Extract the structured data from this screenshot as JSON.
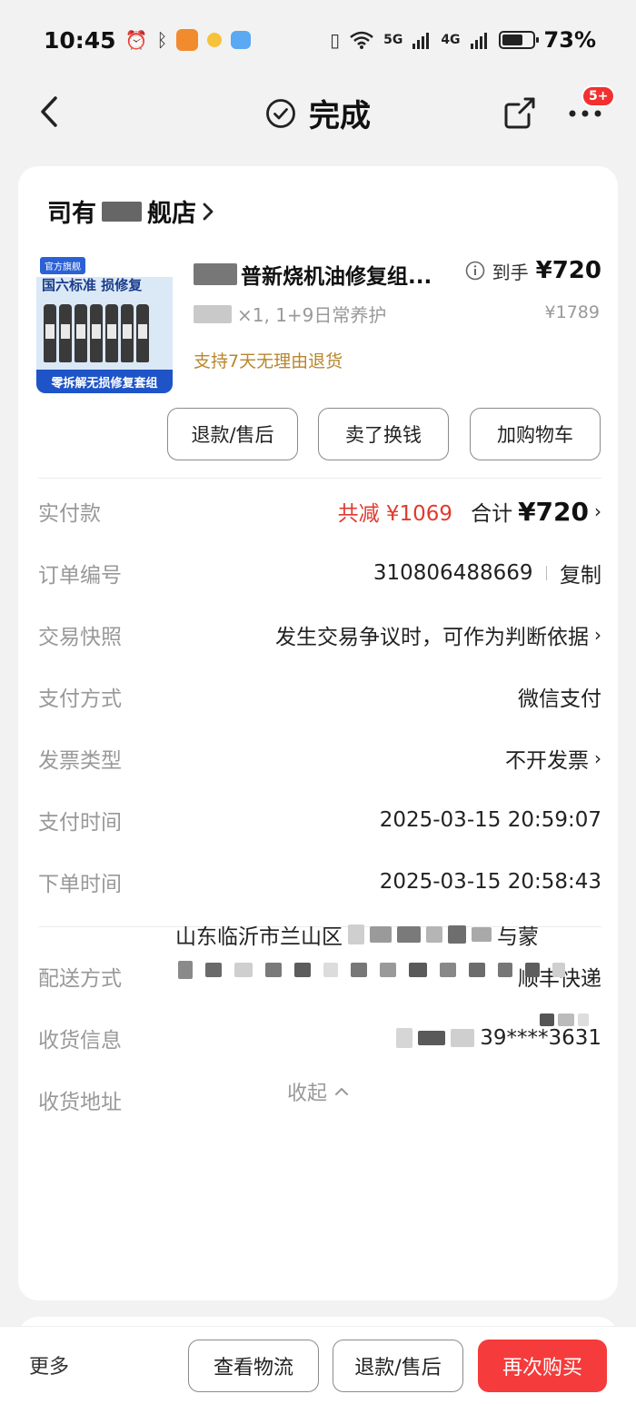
{
  "status_bar": {
    "time": "10:45",
    "network_5g": "5G",
    "network_4g": "4G",
    "battery_text": "73%",
    "battery_level": 0.73
  },
  "nav": {
    "title": "完成",
    "badge": "5+"
  },
  "shop": {
    "name_prefix": "司有",
    "name_suffix": "舰店"
  },
  "product": {
    "title": "普新烧机油修复组...",
    "spec": "×1, 1+9日常养护",
    "price_label": "到手",
    "price": "¥720",
    "original_price": "¥1789",
    "return_policy": "支持7天无理由退货",
    "image": {
      "tag": "官方旗舰",
      "headline": "国六标准 损修复",
      "band": "零拆解无损修复套组"
    }
  },
  "product_actions": [
    "退款/售后",
    "卖了换钱",
    "加购物车"
  ],
  "order": {
    "paid": {
      "label": "实付款",
      "discount": "共减 ¥1069",
      "total_label": "合计",
      "total": "¥720"
    },
    "number": {
      "label": "订单编号",
      "value": "310806488669",
      "copy": "复制"
    },
    "snapshot": {
      "label": "交易快照",
      "value": "发生交易争议时，可作为判断依据"
    },
    "payment": {
      "label": "支付方式",
      "value": "微信支付"
    },
    "invoice": {
      "label": "发票类型",
      "value": "不开发票"
    },
    "pay_time": {
      "label": "支付时间",
      "value": "2025-03-15 20:59:07"
    },
    "order_time": {
      "label": "下单时间",
      "value": "2025-03-15 20:58:43"
    }
  },
  "delivery": {
    "method": {
      "label": "配送方式",
      "value": "顺丰快递"
    },
    "receiver": {
      "label": "收货信息",
      "value": "39****3631"
    },
    "address": {
      "label": "收货地址",
      "line1_prefix": "山东临沂市兰山区",
      "line1_suffix": "与蒙"
    }
  },
  "collapse_label": "收起",
  "bottom_bar": {
    "more": "更多",
    "logistics": "查看物流",
    "refund": "退款/售后",
    "rebuy": "再次购买"
  },
  "colors": {
    "accent_red": "#f53b3b",
    "discount_red": "#e03a2e",
    "policy_gold": "#b8862d"
  }
}
